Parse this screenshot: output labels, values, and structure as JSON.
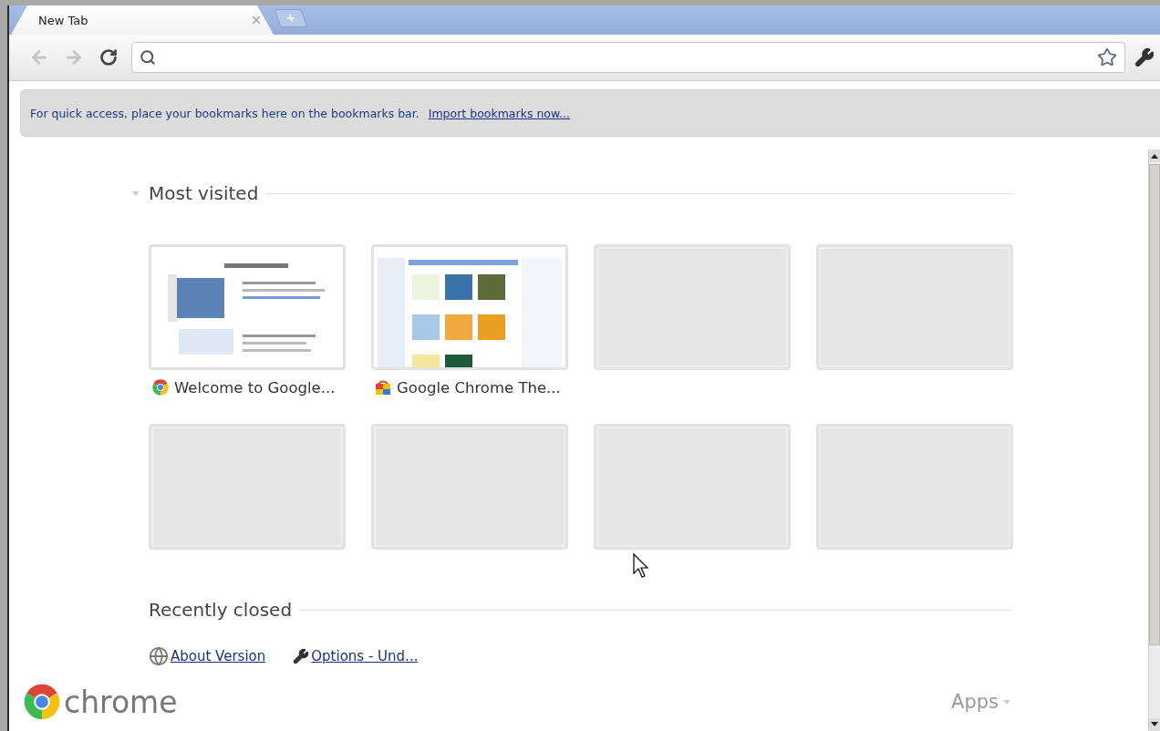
{
  "tab": {
    "title": "New Tab",
    "selected": true
  },
  "toolbar": {
    "back": {
      "disabled": true
    },
    "forward": {
      "disabled": true
    }
  },
  "bookmarks_bar": {
    "message": "For quick access, place your bookmarks here on the bookmarks bar.",
    "link": "Import bookmarks now..."
  },
  "most_visited": {
    "title": "Most visited",
    "expanded": true,
    "tiles": [
      {
        "kind": "page",
        "title": "Welcome to Google..."
      },
      {
        "kind": "page",
        "title": "Google Chrome The..."
      },
      {
        "kind": "empty"
      },
      {
        "kind": "empty"
      },
      {
        "kind": "empty"
      },
      {
        "kind": "empty"
      },
      {
        "kind": "empty"
      },
      {
        "kind": "empty"
      }
    ]
  },
  "recently_closed": {
    "title": "Recently closed",
    "items": [
      {
        "kind": "globe",
        "title": "About Version"
      },
      {
        "kind": "wrench",
        "title": "Options - Und..."
      }
    ]
  },
  "footer": {
    "logo": "chrome",
    "apps": "Apps"
  }
}
